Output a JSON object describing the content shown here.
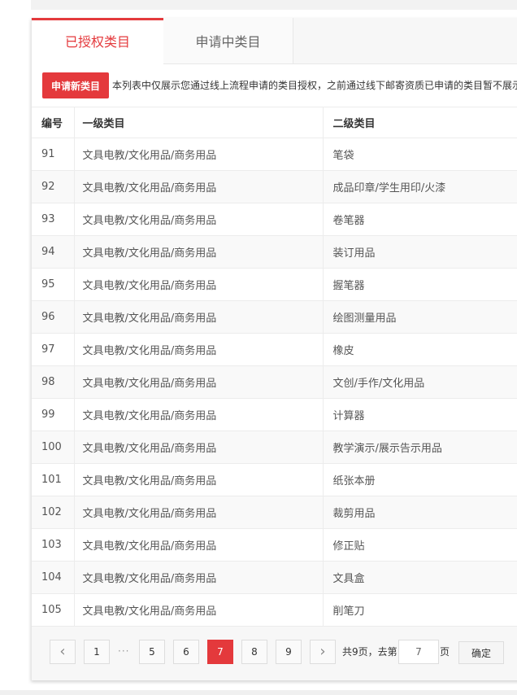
{
  "tabs": [
    {
      "label": "已授权类目",
      "active": true
    },
    {
      "label": "申请中类目",
      "active": false
    }
  ],
  "toolbar": {
    "apply_label": "申请新类目",
    "notice": "本列表中仅展示您通过线上流程申请的类目授权，之前通过线下邮寄资质已申请的类目暂不展示"
  },
  "table": {
    "headers": [
      "编号",
      "一级类目",
      "二级类目"
    ],
    "rows": [
      [
        "91",
        "文具电教/文化用品/商务用品",
        "笔袋"
      ],
      [
        "92",
        "文具电教/文化用品/商务用品",
        "成品印章/学生用印/火漆"
      ],
      [
        "93",
        "文具电教/文化用品/商务用品",
        "卷笔器"
      ],
      [
        "94",
        "文具电教/文化用品/商务用品",
        "装订用品"
      ],
      [
        "95",
        "文具电教/文化用品/商务用品",
        "握笔器"
      ],
      [
        "96",
        "文具电教/文化用品/商务用品",
        "绘图测量用品"
      ],
      [
        "97",
        "文具电教/文化用品/商务用品",
        "橡皮"
      ],
      [
        "98",
        "文具电教/文化用品/商务用品",
        "文创/手作/文化用品"
      ],
      [
        "99",
        "文具电教/文化用品/商务用品",
        "计算器"
      ],
      [
        "100",
        "文具电教/文化用品/商务用品",
        "教学演示/展示告示用品"
      ],
      [
        "101",
        "文具电教/文化用品/商务用品",
        "纸张本册"
      ],
      [
        "102",
        "文具电教/文化用品/商务用品",
        "裁剪用品"
      ],
      [
        "103",
        "文具电教/文化用品/商务用品",
        "修正贴"
      ],
      [
        "104",
        "文具电教/文化用品/商务用品",
        "文具盒"
      ],
      [
        "105",
        "文具电教/文化用品/商务用品",
        "削笔刀"
      ]
    ]
  },
  "pager": {
    "prev": "‹",
    "next": "›",
    "first": "1",
    "ellipsis": "···",
    "pages": [
      "5",
      "6",
      "7",
      "8",
      "9"
    ],
    "current": "7",
    "total_text": "共9页，去第",
    "goto_value": "7",
    "unit": "页",
    "confirm": "确定"
  },
  "colors": {
    "accent": "#e4393c"
  }
}
